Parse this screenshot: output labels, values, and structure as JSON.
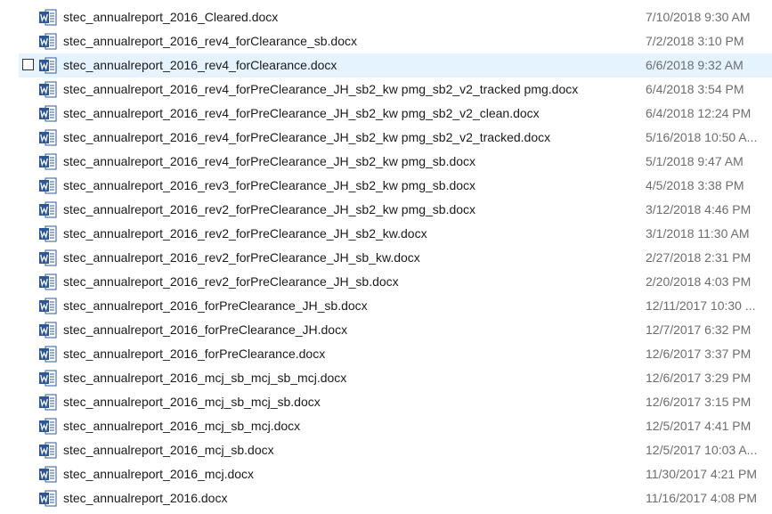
{
  "files": [
    {
      "name": "stec_annualreport_2016_Cleared.docx",
      "date": "7/10/2018 9:30 AM",
      "icon": "word-document-icon",
      "selected": false
    },
    {
      "name": "stec_annualreport_2016_rev4_forClearance_sb.docx",
      "date": "7/2/2018 3:10 PM",
      "icon": "word-document-icon",
      "selected": false
    },
    {
      "name": "stec_annualreport_2016_rev4_forClearance.docx",
      "date": "6/6/2018 9:32 AM",
      "icon": "word-document-icon",
      "selected": true
    },
    {
      "name": "stec_annualreport_2016_rev4_forPreClearance_JH_sb2_kw pmg_sb2_v2_tracked pmg.docx",
      "date": "6/4/2018 3:54 PM",
      "icon": "word-document-icon",
      "selected": false
    },
    {
      "name": "stec_annualreport_2016_rev4_forPreClearance_JH_sb2_kw pmg_sb2_v2_clean.docx",
      "date": "6/4/2018 12:24 PM",
      "icon": "word-document-icon",
      "selected": false
    },
    {
      "name": "stec_annualreport_2016_rev4_forPreClearance_JH_sb2_kw pmg_sb2_v2_tracked.docx",
      "date": "5/16/2018 10:50 A...",
      "icon": "word-document-icon",
      "selected": false
    },
    {
      "name": "stec_annualreport_2016_rev4_forPreClearance_JH_sb2_kw pmg_sb.docx",
      "date": "5/1/2018 9:47 AM",
      "icon": "word-document-icon",
      "selected": false
    },
    {
      "name": "stec_annualreport_2016_rev3_forPreClearance_JH_sb2_kw pmg_sb.docx",
      "date": "4/5/2018 3:38 PM",
      "icon": "word-document-icon",
      "selected": false
    },
    {
      "name": "stec_annualreport_2016_rev2_forPreClearance_JH_sb2_kw pmg_sb.docx",
      "date": "3/12/2018 4:46 PM",
      "icon": "word-document-icon",
      "selected": false
    },
    {
      "name": "stec_annualreport_2016_rev2_forPreClearance_JH_sb2_kw.docx",
      "date": "3/1/2018 11:30 AM",
      "icon": "word-document-icon",
      "selected": false
    },
    {
      "name": "stec_annualreport_2016_rev2_forPreClearance_JH_sb_kw.docx",
      "date": "2/27/2018 2:31 PM",
      "icon": "word-document-icon",
      "selected": false
    },
    {
      "name": "stec_annualreport_2016_rev2_forPreClearance_JH_sb.docx",
      "date": "2/20/2018 4:03 PM",
      "icon": "word-document-icon",
      "selected": false
    },
    {
      "name": "stec_annualreport_2016_forPreClearance_JH_sb.docx",
      "date": "12/11/2017 10:30 ...",
      "icon": "word-document-icon",
      "selected": false
    },
    {
      "name": "stec_annualreport_2016_forPreClearance_JH.docx",
      "date": "12/7/2017 6:32 PM",
      "icon": "word-document-icon",
      "selected": false
    },
    {
      "name": "stec_annualreport_2016_forPreClearance.docx",
      "date": "12/6/2017 3:37 PM",
      "icon": "word-document-icon",
      "selected": false
    },
    {
      "name": "stec_annualreport_2016_mcj_sb_mcj_sb_mcj.docx",
      "date": "12/6/2017 3:29 PM",
      "icon": "word-document-icon",
      "selected": false
    },
    {
      "name": "stec_annualreport_2016_mcj_sb_mcj_sb.docx",
      "date": "12/6/2017 3:15 PM",
      "icon": "word-document-icon",
      "selected": false
    },
    {
      "name": "stec_annualreport_2016_mcj_sb_mcj.docx",
      "date": "12/5/2017 4:41 PM",
      "icon": "word-document-icon",
      "selected": false
    },
    {
      "name": "stec_annualreport_2016_mcj_sb.docx",
      "date": "12/5/2017 10:03 A...",
      "icon": "word-document-icon",
      "selected": false
    },
    {
      "name": "stec_annualreport_2016_mcj.docx",
      "date": "11/30/2017 4:21 PM",
      "icon": "word-document-icon",
      "selected": false
    },
    {
      "name": "stec_annualreport_2016.docx",
      "date": "11/16/2017 4:08 PM",
      "icon": "word-document-icon",
      "selected": false
    }
  ],
  "colors": {
    "selection_bg": "#e5f3ff",
    "word_blue": "#2b579a",
    "name_text": "#1a1a1a",
    "date_text": "#6d6d6d"
  }
}
